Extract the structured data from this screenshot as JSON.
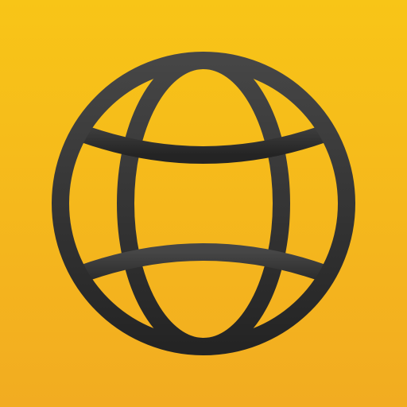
{
  "icon": {
    "name": "globe-icon",
    "background_top_color": "#F8C517",
    "background_bottom_color": "#F2AC21",
    "glyph_top_color": "#464646",
    "glyph_bottom_color": "#242424"
  }
}
